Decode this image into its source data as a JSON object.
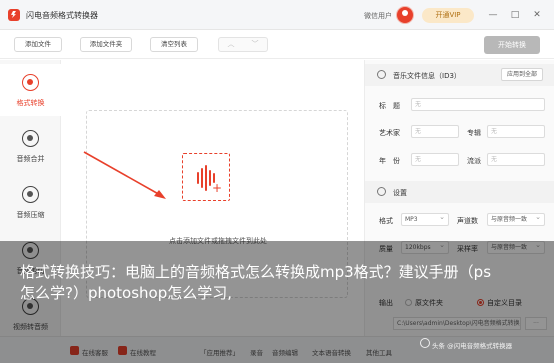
{
  "titlebar": {
    "app_title": "闪电音频格式转换器",
    "login_text": "微信用户",
    "vip_label": "开通VIP",
    "min_glyph": "—",
    "max_glyph": "□",
    "close_glyph": "✕"
  },
  "toolbar": {
    "add_file": "添加文件",
    "add_folder": "添加文件夹",
    "clear_list": "清空列表",
    "prev_glyph": "︿",
    "next_glyph": "﹀",
    "start": "开始转换"
  },
  "sidebar": {
    "items": [
      {
        "label": "格式转换",
        "icon": "convert-icon",
        "active": true
      },
      {
        "label": "音频合并",
        "icon": "merge-icon",
        "active": false
      },
      {
        "label": "音频压缩",
        "icon": "compress-icon",
        "active": false
      },
      {
        "label": "音频剪切",
        "icon": "cut-icon",
        "active": false
      },
      {
        "label": "视频转音频",
        "icon": "video-audio-icon",
        "active": false
      }
    ]
  },
  "main": {
    "drop_hint": "点击添加文件或拖拽文件到此处"
  },
  "right_panel": {
    "id3_title": "音乐文件信息（ID3）",
    "apply_all": "应用到全部",
    "fields": {
      "title_label": "标　题",
      "title_placeholder": "无",
      "artist_label": "艺术家",
      "artist_placeholder": "无",
      "album_label": "专辑",
      "album_placeholder": "无",
      "year_label": "年　份",
      "year_placeholder": "无",
      "genre_label": "流派",
      "genre_placeholder": "无"
    },
    "settings_title": "设置",
    "format_label": "格式",
    "format_value": "MP3",
    "channel_label": "声道数",
    "channel_value": "与原音频一致",
    "quality_label": "质量",
    "quality_value": "120kbps",
    "samplerate_label": "采样率",
    "samplerate_value": "与原音频一致",
    "output_label": "输出",
    "output_original": "原文件夹",
    "output_custom": "自定义目录",
    "output_path": "C:\\Users\\admin\\Desktop\\闪电音频格式转换"
  },
  "bottombar": {
    "items": [
      "在线客服",
      "在线教程",
      "「应用推荐」",
      "录音",
      "音频编辑",
      "文本语音转换",
      "其他工具"
    ]
  },
  "overlay": {
    "caption": "格式转换技巧：电脑上的音频格式怎么转换成mp3格式？建议手册（ps怎么学?）photoshop怎么学习,",
    "watermark": "头条 @闪电音频格式转换器"
  },
  "colors": {
    "accent": "#e8402b",
    "disabled_button": "#b8b8b8",
    "vip_bg": "#fbe8c8"
  }
}
